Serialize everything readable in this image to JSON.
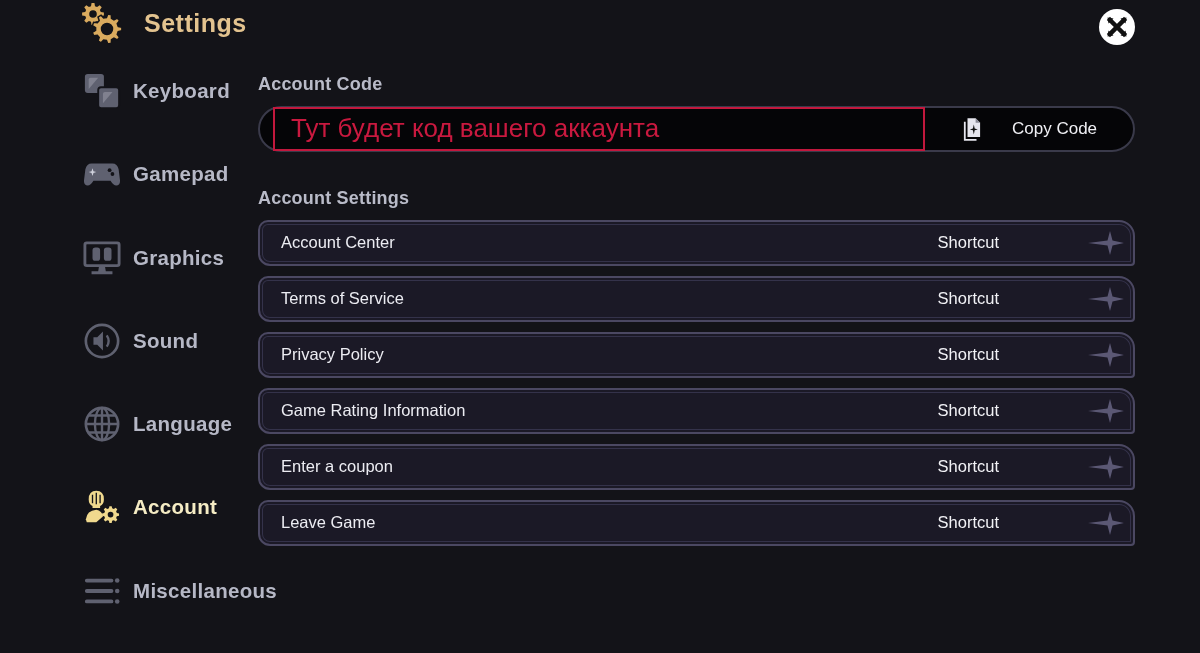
{
  "header": {
    "title": "Settings"
  },
  "sidebar": {
    "items": [
      {
        "label": "Keyboard",
        "selected": false
      },
      {
        "label": "Gamepad",
        "selected": false
      },
      {
        "label": "Graphics",
        "selected": false
      },
      {
        "label": "Sound",
        "selected": false
      },
      {
        "label": "Language",
        "selected": false
      },
      {
        "label": "Account",
        "selected": true
      },
      {
        "label": "Miscellaneous",
        "selected": false
      }
    ]
  },
  "account_code": {
    "label": "Account Code",
    "value": "Тут будет код вашего аккаунта",
    "copy_button": "Copy Code"
  },
  "account_settings": {
    "title": "Account Settings",
    "rows": [
      {
        "label": "Account Center",
        "action": "Shortcut"
      },
      {
        "label": "Terms of Service",
        "action": "Shortcut"
      },
      {
        "label": "Privacy Policy",
        "action": "Shortcut"
      },
      {
        "label": "Game Rating Information",
        "action": "Shortcut"
      },
      {
        "label": "Enter a coupon",
        "action": "Shortcut"
      },
      {
        "label": "Leave Game",
        "action": "Shortcut"
      }
    ]
  }
}
